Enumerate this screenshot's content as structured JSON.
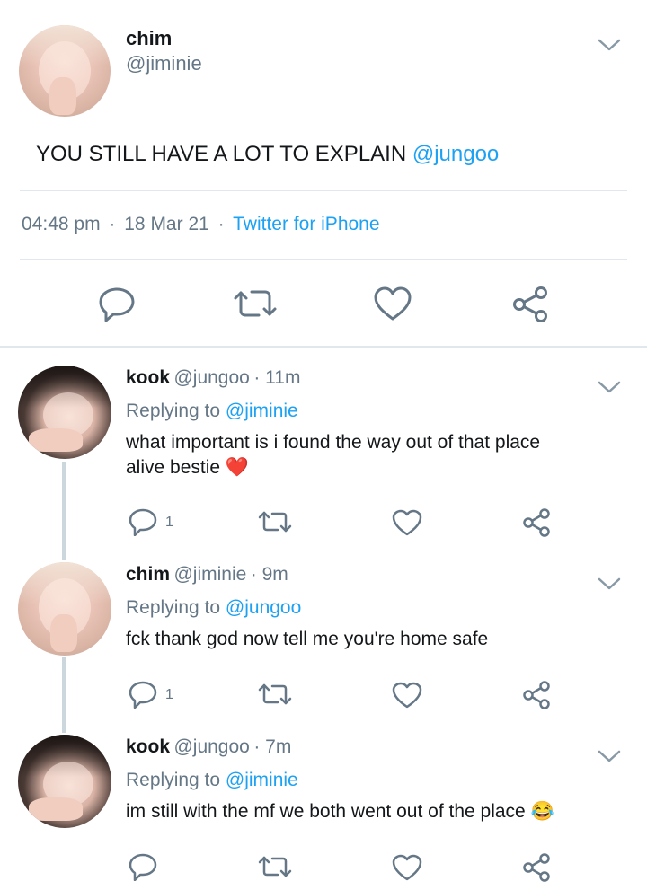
{
  "main_tweet": {
    "name": "chim",
    "handle": "@jiminie",
    "text": "YOU STILL HAVE A LOT TO EXPLAIN ",
    "mention": "@jungoo",
    "time": "04:48 pm",
    "sep1": "·",
    "date": "18 Mar 21",
    "sep2": "·",
    "source": "Twitter for iPhone"
  },
  "replies": [
    {
      "name": "kook",
      "handle": "@jungoo",
      "time": "· 11m",
      "replying_prefix": "Replying to ",
      "replying_to": "@jiminie",
      "text_line1": "what important is i found the way out of that place",
      "text_line2": "alive bestie",
      "emoji": "❤️",
      "reply_count": "1"
    },
    {
      "name": "chim",
      "handle": "@jiminie",
      "time": "· 9m",
      "replying_prefix": "Replying to ",
      "replying_to": "@jungoo",
      "text_line1": "fck thank god now tell me you're home safe",
      "reply_count": "1"
    },
    {
      "name": "kook",
      "handle": "@jungoo",
      "time": "· 7m",
      "replying_prefix": "Replying to ",
      "replying_to": "@jiminie",
      "text_line1": "im still with the mf we both went out of the place",
      "emoji": "😂"
    }
  ],
  "icons": {
    "reply": "reply-icon",
    "retweet": "retweet-icon",
    "like": "heart-icon",
    "share": "share-icon",
    "menu": "chevron-down-icon"
  },
  "colors": {
    "link": "#1da1f2",
    "secondary_text": "#657786",
    "icon": "#657786",
    "divider": "#e1e8ed"
  }
}
